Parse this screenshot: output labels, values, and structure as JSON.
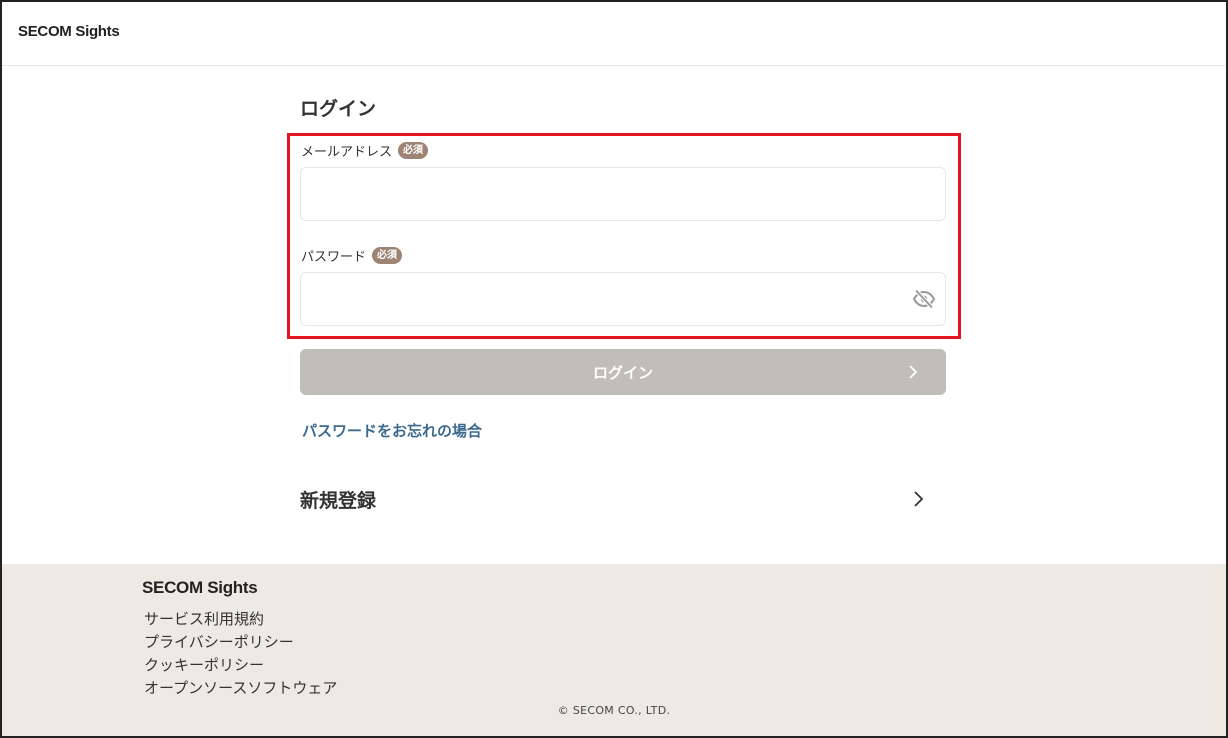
{
  "header": {
    "logo": "SECOM Sights"
  },
  "login": {
    "title": "ログイン",
    "email": {
      "label": "メールアドレス",
      "required_badge": "必須",
      "value": "",
      "placeholder": ""
    },
    "password": {
      "label": "パスワード",
      "required_badge": "必須",
      "value": "",
      "placeholder": "",
      "toggle_icon": "eye-slash-icon"
    },
    "submit_label": "ログイン",
    "forgot_password_link": "パスワードをお忘れの場合",
    "register_label": "新規登録"
  },
  "footer": {
    "logo": "SECOM Sights",
    "links": [
      "サービス利用規約",
      "プライバシーポリシー",
      "クッキーポリシー",
      "オープンソースソフトウェア"
    ],
    "copyright": "© SECOM CO., LTD."
  },
  "colors": {
    "highlight_border": "#e3161f",
    "required_badge": "#9e8474",
    "login_button_disabled": "#c1bdb9",
    "link": "#3d6b8f",
    "footer_background": "#eeeae3"
  }
}
